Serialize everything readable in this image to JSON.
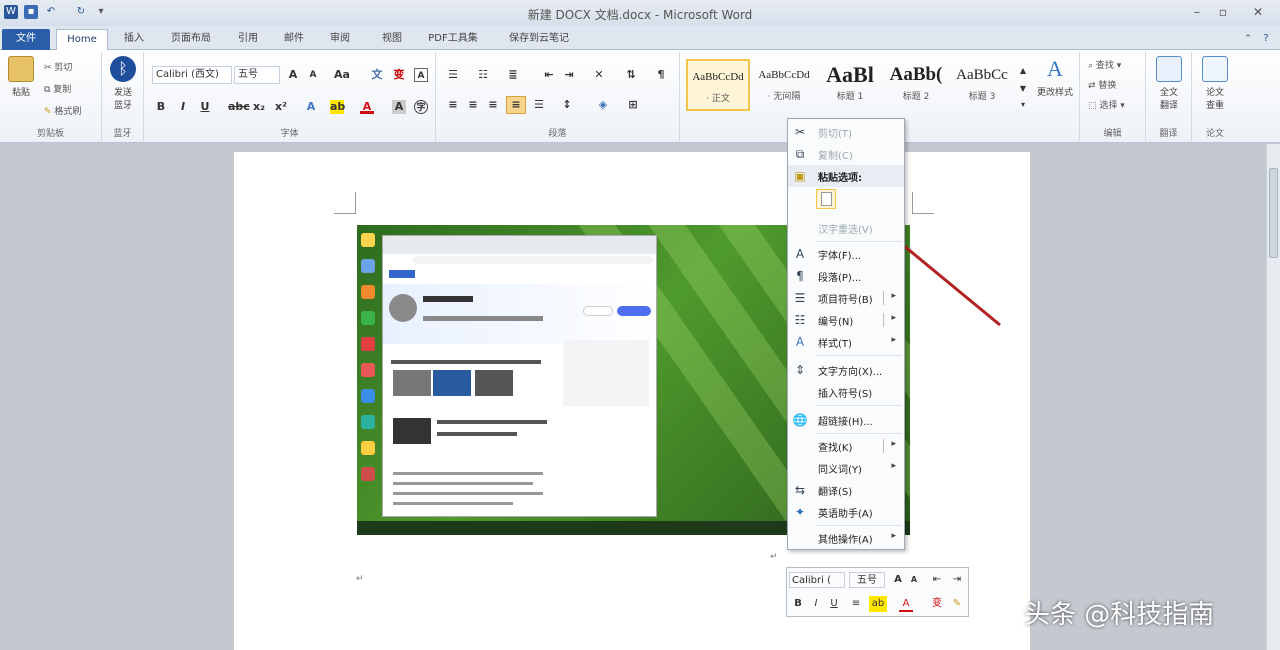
{
  "window": {
    "title": "新建 DOCX 文档.docx - Microsoft Word"
  },
  "tabs": [
    "文件",
    "Home",
    "插入",
    "页面布局",
    "引用",
    "邮件",
    "审阅",
    "视图",
    "PDF工具集",
    "保存到云笔记"
  ],
  "clipboard": {
    "paste": "粘贴",
    "cut": "剪切",
    "copy": "复制",
    "format_painter": "格式刷",
    "group": "剪贴板"
  },
  "bluetooth": {
    "label": "发送",
    "label2": "蓝牙",
    "group": "蓝牙"
  },
  "font": {
    "name": "Calibri (西文)",
    "size": "五号",
    "group": "字体"
  },
  "paragraph": {
    "group": "段落"
  },
  "styles": [
    {
      "sample": "AaBbCcDd",
      "name": "· 正文"
    },
    {
      "sample": "AaBbCcDd",
      "name": "· 无间隔"
    },
    {
      "sample": "AaBl",
      "name": "标题 1"
    },
    {
      "sample": "AaBb(",
      "name": "标题 2"
    },
    {
      "sample": "AaBbCc",
      "name": "标题 3"
    }
  ],
  "styles_group": {
    "change": "更改样式"
  },
  "editing": {
    "find": "查找",
    "replace": "替换",
    "select": "选择",
    "group": "编辑"
  },
  "translate": {
    "label": "全文",
    "label2": "翻译",
    "group": "翻译"
  },
  "paper": {
    "label": "论文",
    "label2": "查重",
    "group": "论文"
  },
  "context_menu": [
    {
      "label": "剪切(T)",
      "disabled": true,
      "icon": "scissors-icon"
    },
    {
      "label": "复制(C)",
      "disabled": true,
      "icon": "copy-icon"
    },
    {
      "label": "粘贴选项:",
      "disabled": false,
      "icon": "paste-icon"
    },
    {
      "label": "汉字重选(V)",
      "disabled": true,
      "icon": ""
    },
    {
      "label": "字体(F)...",
      "disabled": false,
      "icon": "font-icon"
    },
    {
      "label": "段落(P)...",
      "disabled": false,
      "icon": "paragraph-icon"
    },
    {
      "label": "项目符号(B)",
      "disabled": false,
      "icon": "bullets-icon",
      "submenu": true
    },
    {
      "label": "编号(N)",
      "disabled": false,
      "icon": "numbering-icon",
      "submenu": true
    },
    {
      "label": "样式(T)",
      "disabled": false,
      "icon": "styles-icon",
      "submenu": true
    },
    {
      "label": "文字方向(X)...",
      "disabled": false,
      "icon": "text-direction-icon"
    },
    {
      "label": "插入符号(S)",
      "disabled": false,
      "icon": ""
    },
    {
      "label": "超链接(H)...",
      "disabled": false,
      "icon": "hyperlink-icon"
    },
    {
      "label": "查找(K)",
      "disabled": false,
      "icon": "",
      "submenu": true
    },
    {
      "label": "同义词(Y)",
      "disabled": false,
      "icon": "",
      "submenu": true
    },
    {
      "label": "翻译(S)",
      "disabled": false,
      "icon": "translate-icon"
    },
    {
      "label": "英语助手(A)",
      "disabled": false,
      "icon": "english-assistant-icon"
    },
    {
      "label": "其他操作(A)",
      "disabled": false,
      "icon": "",
      "submenu": true
    }
  ],
  "mini_toolbar": {
    "font": "Calibri (",
    "size": "五号"
  },
  "watermark": "头条 @科技指南",
  "colors": {
    "accent": "#2a5ea9",
    "arrow": "#b22222",
    "selection": "#f3c54b"
  }
}
